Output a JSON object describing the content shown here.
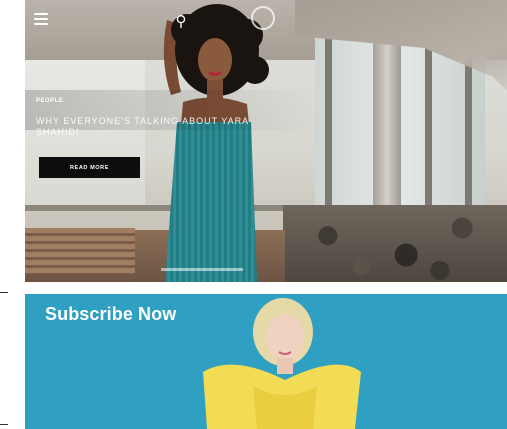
{
  "hero": {
    "category": "PEOPLE",
    "headline": "WHY EVERYONE'S TALKING ABOUT YARA SHAHIDI",
    "read_more_label": "READ MORE"
  },
  "subscribe": {
    "title": "Subscribe Now"
  },
  "colors": {
    "subscribe_bg": "#2f9fc2",
    "button_bg": "#0d0d0d",
    "dress_teal": "#1f7f86",
    "top_yellow": "#f2dc55"
  },
  "icons": [
    "menu-icon",
    "logo-icon",
    "circle-icon"
  ]
}
